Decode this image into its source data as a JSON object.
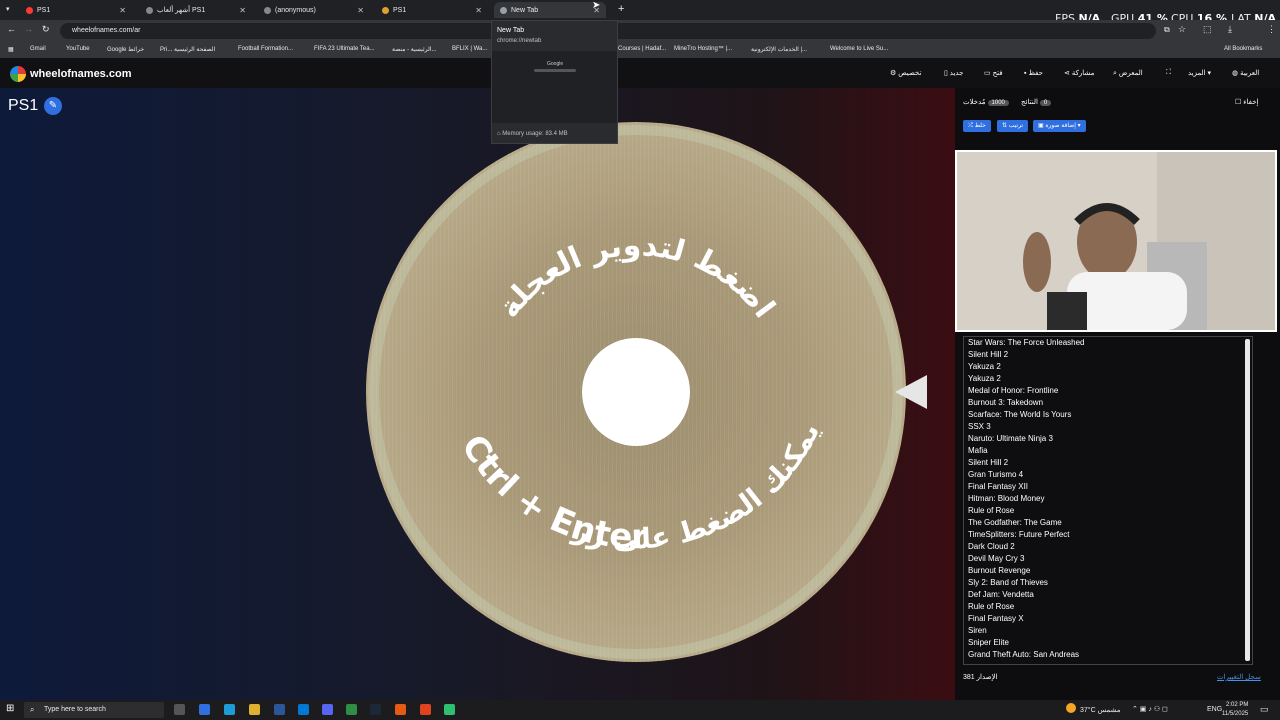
{
  "browser": {
    "tabs": [
      {
        "label": "PS1",
        "active": false
      },
      {
        "label": "أشهر ألعاب PS1",
        "active": false
      },
      {
        "label": "(anonymous)",
        "active": false
      },
      {
        "label": "PS1",
        "active": false
      },
      {
        "label": "New Tab",
        "active": true
      }
    ],
    "url": "wheelofnames.com/ar",
    "bookmarks": [
      "Gmail",
      "YouTube",
      "Google خرائط",
      "Pri... الصفحة الرئيسية",
      "Football Formation...",
      "FIFA 23 Ultimate Tea...",
      "الرئيسية - منصة...",
      "BFLIX | Wa...",
      "Courses | Hadaf...",
      "MineTro Hosting™ |...",
      "الخدمات الإلكترونية |...",
      "Welcome to Live Su...",
      "All Bookmarks"
    ],
    "tab_popup": {
      "title": "New Tab",
      "url": "chrome://newtab",
      "thumb_label": "Google",
      "memory": "Memory usage: 83.4 MB"
    }
  },
  "hud": {
    "fps_label": "FPS",
    "fps_value": "N/A",
    "gpu_label": "GPU",
    "gpu_value": "41 %",
    "cpu_label": "CPU",
    "cpu_value": "16 %",
    "lat_label": "LAT",
    "lat_value": "N/A"
  },
  "site": {
    "logo": "wheelofnames.com",
    "header_buttons": [
      "تخصيص",
      "جديد",
      "فتح",
      "حفظ",
      "مشاركة",
      "المعرض",
      "المزيد",
      "العربية"
    ]
  },
  "wheel": {
    "title": "PS1",
    "text_top": "اضغط لتدوير العجلة",
    "text_bottom_ar": "أو يمكنك الضغط على زر",
    "text_bottom_keys": "Ctrl + Enter"
  },
  "panel": {
    "tab_entries": "مُدخلات",
    "entries_count": "1000",
    "tab_results": "النتائج",
    "results_count": "0",
    "hide_label": "إخفاء",
    "shuffle_label": "خلط",
    "sort_label": "ترتيب",
    "add_image_label": "إضافة صورة",
    "entries": [
      "Star Wars: The Force Unleashed",
      "Silent Hill 2",
      "Yakuza 2",
      "Yakuza 2",
      "Medal of Honor: Frontline",
      "Burnout 3: Takedown",
      "Scarface: The World Is Yours",
      "SSX 3",
      "Naruto: Ultimate Ninja 3",
      "Mafia",
      "Silent Hill 2",
      "Gran Turismo 4",
      "Final Fantasy XII",
      "Hitman: Blood Money",
      "Rule of Rose",
      "The Godfather: The Game",
      "TimeSplitters: Future Perfect",
      "Dark Cloud 2",
      "Devil May Cry 3",
      "Burnout Revenge",
      "Sly 2: Band of Thieves",
      "Def Jam: Vendetta",
      "Rule of Rose",
      "Final Fantasy X",
      "Siren",
      "Sniper Elite",
      "Grand Theft Auto: San Andreas"
    ],
    "version_label": "الإصدار 381",
    "changelog_label": "سجل التغييرات"
  },
  "taskbar": {
    "search_placeholder": "Type here to search",
    "weather": "37°C مشمس",
    "lang": "ENG",
    "time": "2:02 PM",
    "date": "11/5/2025"
  },
  "colors": {
    "accent": "#2f6fe0",
    "wheel": "#a99978"
  }
}
